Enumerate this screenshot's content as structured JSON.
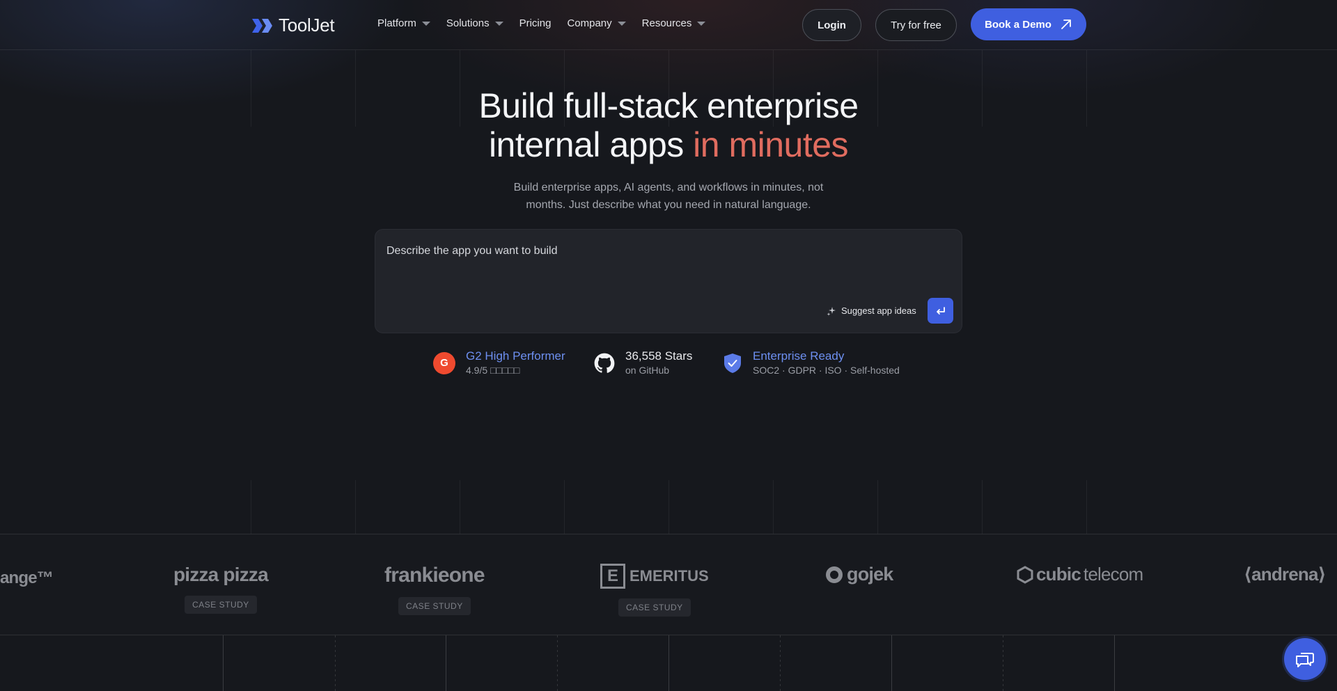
{
  "brand": {
    "name": "ToolJet",
    "accent_color": "#3f5fe0",
    "highlight_color": "#e06c5f"
  },
  "nav": {
    "items": [
      {
        "label": "Platform",
        "has_dropdown": true
      },
      {
        "label": "Solutions",
        "has_dropdown": true
      },
      {
        "label": "Pricing",
        "has_dropdown": false
      },
      {
        "label": "Company",
        "has_dropdown": true
      },
      {
        "label": "Resources",
        "has_dropdown": true
      }
    ],
    "login_label": "Login",
    "try_label": "Try for free",
    "demo_label": "Book a Demo",
    "demo_icon": "arrow-up-right-icon"
  },
  "hero": {
    "title_line1": "Build full-stack enterprise",
    "title_line2_plain": "internal apps ",
    "title_line2_accent": "in minutes",
    "subtitle_line1": "Build enterprise apps, AI agents, and workflows in minutes, not",
    "subtitle_line2": "months. Just describe what you need in natural language."
  },
  "prompt": {
    "placeholder": "Describe the app you want to build",
    "suggest_label": "Suggest app ideas",
    "suggest_icon": "sparkle-icon",
    "send_icon": "enter-icon"
  },
  "badges": {
    "g2": {
      "icon": "g2-logo-icon",
      "title": "G2 High Performer",
      "subtitle": "4.9/5 □□□□□"
    },
    "github": {
      "icon": "github-icon",
      "title": "36,558 Stars",
      "subtitle": "on GitHub"
    },
    "enterprise": {
      "icon": "shield-check-icon",
      "title": "Enterprise Ready",
      "subtitle": "SOC2 · GDPR · ISO · Self-hosted"
    }
  },
  "clients": [
    {
      "name": "ange™",
      "case_study": ""
    },
    {
      "name": "pizza pizza",
      "case_study": "CASE STUDY"
    },
    {
      "name": "frankieone",
      "case_study": "CASE STUDY"
    },
    {
      "name": "EMERITUS",
      "case_study": "CASE STUDY"
    },
    {
      "name": "gojek",
      "case_study": ""
    },
    {
      "name": "cubic",
      "name_light": "telecom",
      "case_study": ""
    },
    {
      "name": "⟨andrena⟩",
      "case_study": ""
    }
  ],
  "chat": {
    "icon": "chat-bubbles-icon"
  }
}
